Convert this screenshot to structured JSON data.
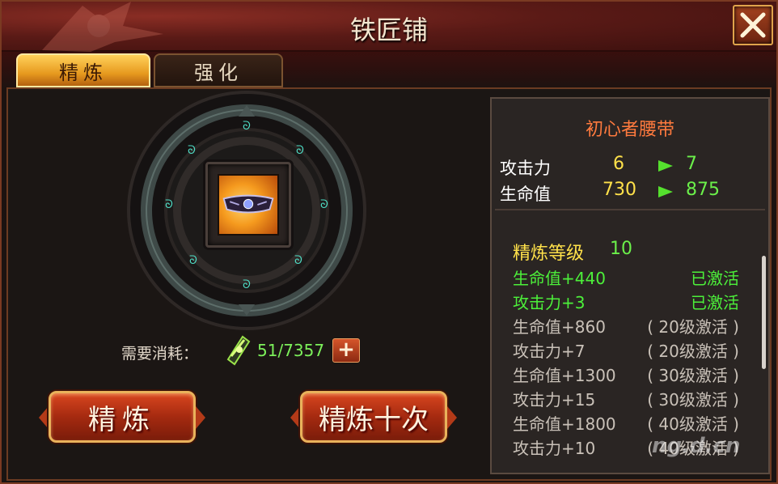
{
  "window": {
    "title": "铁匠铺"
  },
  "tabs": [
    {
      "label": "精炼",
      "active": true
    },
    {
      "label": "强化",
      "active": false
    }
  ],
  "refine": {
    "cost_label": "需要消耗：",
    "cost_value": "51/7357",
    "add_label": "+",
    "refine_button": "精炼",
    "refine_ten_button": "精炼十次"
  },
  "item": {
    "name": "初心者腰带",
    "stats": [
      {
        "name": "攻击力",
        "old": "6",
        "new": "7"
      },
      {
        "name": "生命值",
        "old": "730",
        "new": "875"
      }
    ],
    "refine_level_label": "精炼等级",
    "refine_level": "10",
    "attributes": [
      {
        "name": "生命值+440",
        "status": "已激活",
        "active": true
      },
      {
        "name": "攻击力+3",
        "status": "已激活",
        "active": true
      },
      {
        "name": "生命值+860",
        "status": "( 20级激活 )",
        "active": false
      },
      {
        "name": "攻击力+7",
        "status": "( 20级激活 )",
        "active": false
      },
      {
        "name": "生命值+1300",
        "status": "( 30级激活 )",
        "active": false
      },
      {
        "name": "攻击力+15",
        "status": "( 30级激活 )",
        "active": false
      },
      {
        "name": "生命值+1800",
        "status": "( 40级激活 )",
        "active": false
      },
      {
        "name": "攻击力+10",
        "status": "( 40级激活 )",
        "active": false
      }
    ]
  },
  "watermark": "ng.d.cn",
  "colors": {
    "accent_gold": "#e79a1f",
    "button_red": "#a52a10",
    "active_green": "#4cf03a",
    "item_name_orange": "#ff7a3e",
    "stat_yellow": "#ffe14a"
  }
}
